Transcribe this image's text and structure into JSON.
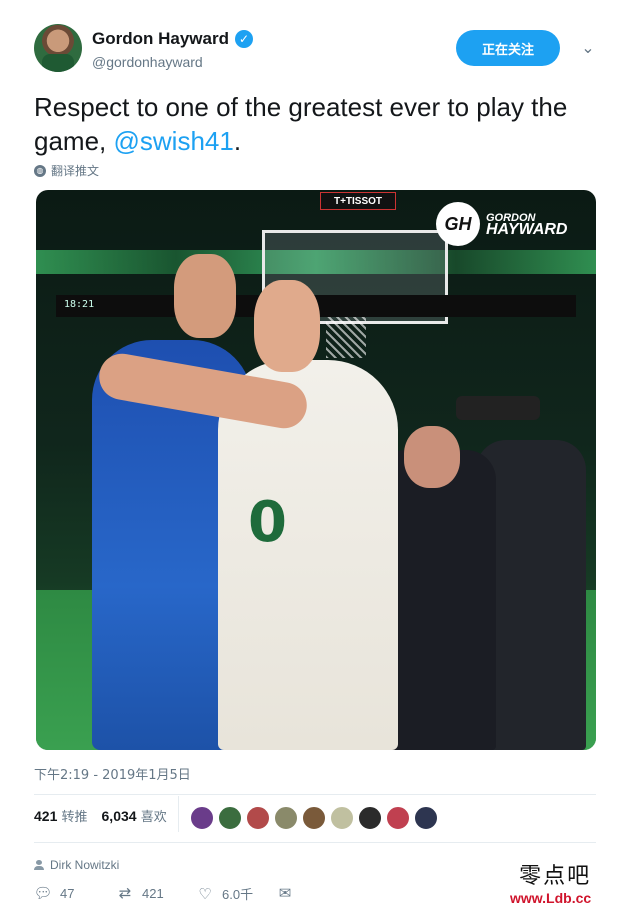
{
  "author": {
    "display_name": "Gordon Hayward",
    "handle": "@gordonhayward",
    "verified_icon": "verified-badge-icon"
  },
  "header": {
    "follow_label": "正在关注",
    "menu_icon": "chevron-down-icon"
  },
  "tweet": {
    "text": "Respect to one of the greatest ever to play the game, ",
    "mention": "@swish41",
    "trailing": ".",
    "translate_label": "翻译推文"
  },
  "media": {
    "logo_initials": "GH",
    "logo_line1": "GORDON",
    "logo_line2": "HAYWARD",
    "sign_text": "T+TISSOT",
    "scoreboard_text": "18:21",
    "jersey_number": "0"
  },
  "timestamp": "下午2:19 - 2019年1月5日",
  "stats": {
    "retweets_count": "421",
    "retweets_label": "转推",
    "likes_count": "6,034",
    "likes_label": "喜欢"
  },
  "likers_colors": [
    "#6a3c8a",
    "#3b6d3f",
    "#b24a4a",
    "#8a8a6a",
    "#7a5a3a",
    "#c0c0a0",
    "#2b2b2b",
    "#c04050",
    "#2d3550"
  ],
  "context": {
    "name": "Dirk Nowitzki"
  },
  "actions": {
    "reply_count": "47",
    "retweet_count": "421",
    "like_count": "6.0千"
  },
  "watermark": {
    "line1": "零点吧",
    "line2": "www.Ldb.cc"
  },
  "colors": {
    "accent": "#1da1f2",
    "secondary_text": "#657786"
  }
}
